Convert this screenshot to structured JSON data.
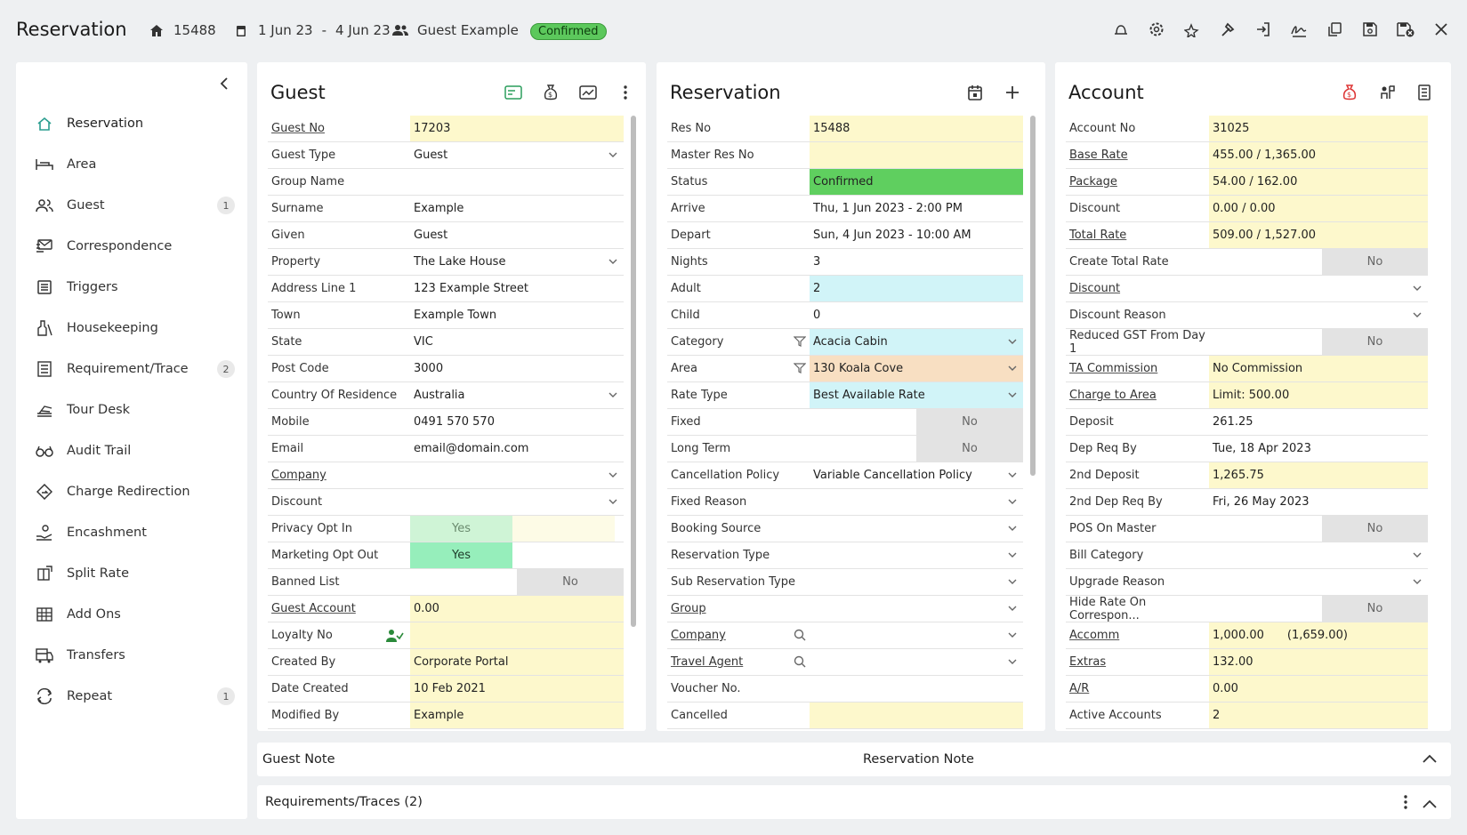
{
  "header": {
    "title": "Reservation",
    "res_no": "15488",
    "dates_from": "1 Jun 23",
    "dates_sep": "-",
    "dates_to": "4 Jun 23",
    "guest": "Guest Example",
    "status": "Confirmed"
  },
  "toolbar_icons": [
    "bell-icon",
    "gear-icon",
    "sparkle-star-icon",
    "hammer-icon",
    "sign-in-icon",
    "signature-icon",
    "copy-icon",
    "save-icon",
    "save-close-icon",
    "close-icon"
  ],
  "sidebar": {
    "items": [
      {
        "label": "Reservation",
        "icon": "home-icon",
        "count": ""
      },
      {
        "label": "Area",
        "icon": "bed-icon",
        "count": ""
      },
      {
        "label": "Guest",
        "icon": "users-icon",
        "count": "1"
      },
      {
        "label": "Correspondence",
        "icon": "mail-icon",
        "count": ""
      },
      {
        "label": "Triggers",
        "icon": "calendar-list-icon",
        "count": ""
      },
      {
        "label": "Housekeeping",
        "icon": "cleaning-icon",
        "count": ""
      },
      {
        "label": "Requirement/Trace",
        "icon": "list-icon",
        "count": "2"
      },
      {
        "label": "Tour Desk",
        "icon": "tour-icon",
        "count": ""
      },
      {
        "label": "Audit Trail",
        "icon": "glasses-icon",
        "count": ""
      },
      {
        "label": "Charge Redirection",
        "icon": "redirect-icon",
        "count": ""
      },
      {
        "label": "Encashment",
        "icon": "hand-coin-icon",
        "count": ""
      },
      {
        "label": "Split Rate",
        "icon": "split-icon",
        "count": ""
      },
      {
        "label": "Add Ons",
        "icon": "grid-icon",
        "count": ""
      },
      {
        "label": "Transfers",
        "icon": "bus-icon",
        "count": ""
      },
      {
        "label": "Repeat",
        "icon": "repeat-icon",
        "count": "1"
      }
    ]
  },
  "guest_panel": {
    "title": "Guest",
    "rows": [
      {
        "label": "Guest No",
        "value": "17203",
        "link": true,
        "bg": "yel"
      },
      {
        "label": "Guest Type",
        "value": "Guest",
        "dd": true
      },
      {
        "label": "Group Name",
        "value": ""
      },
      {
        "label": "Surname",
        "value": "Example"
      },
      {
        "label": "Given",
        "value": "Guest"
      },
      {
        "label": "Property",
        "value": "The Lake House",
        "dd": true
      },
      {
        "label": "Address Line 1",
        "value": "123 Example Street"
      },
      {
        "label": "Town",
        "value": "Example Town"
      },
      {
        "label": "State",
        "value": "VIC"
      },
      {
        "label": "Post Code",
        "value": "3000"
      },
      {
        "label": "Country Of Residence",
        "value": "Australia",
        "dd": true
      },
      {
        "label": "Mobile",
        "value": "0491 570 570"
      },
      {
        "label": "Email",
        "value": "email@domain.com"
      },
      {
        "label": "Company",
        "value": "",
        "link": true,
        "dd": true
      },
      {
        "label": "Discount",
        "value": "",
        "dd": true
      },
      {
        "label": "Privacy Opt In",
        "value": "Yes",
        "toggle": "yes-light"
      },
      {
        "label": "Marketing Opt Out",
        "value": "Yes",
        "toggle": "yes"
      },
      {
        "label": "Banned List",
        "value": "No",
        "toggle": "no"
      },
      {
        "label": "Guest Account",
        "value": "0.00",
        "link": true,
        "bg": "yel"
      },
      {
        "label": "Loyalty No",
        "value": "",
        "bg": "yel",
        "icon": "user-check-icon"
      },
      {
        "label": "Created By",
        "value": "Corporate Portal",
        "bg": "yel"
      },
      {
        "label": "Date Created",
        "value": "10 Feb 2021",
        "bg": "yel"
      },
      {
        "label": "Modified By",
        "value": "Example",
        "bg": "yel"
      }
    ]
  },
  "reservation_panel": {
    "title": "Reservation",
    "rows": [
      {
        "label": "Res No",
        "value": "15488",
        "bg": "yel"
      },
      {
        "label": "Master Res No",
        "value": "",
        "bg": "yel"
      },
      {
        "label": "Status",
        "value": "Confirmed",
        "bg": "grn"
      },
      {
        "label": "Arrive",
        "value": "Thu, 1 Jun 2023 - 2:00 PM"
      },
      {
        "label": "Depart",
        "value": "Sun, 4 Jun 2023 - 10:00 AM"
      },
      {
        "label": "Nights",
        "value": "3"
      },
      {
        "label": "Adult",
        "value": "2",
        "bg": "cyan"
      },
      {
        "label": "Child",
        "value": "0"
      },
      {
        "label": "Category",
        "value": "Acacia Cabin",
        "bg": "cyan",
        "dd": true,
        "filter": true
      },
      {
        "label": "Area",
        "value": "130 Koala Cove",
        "bg": "peach",
        "dd": true,
        "filter": true
      },
      {
        "label": "Rate Type",
        "value": "Best Available Rate",
        "bg": "cyan",
        "dd": true
      },
      {
        "label": "Fixed",
        "value": "No",
        "toggle": "no"
      },
      {
        "label": "Long Term",
        "value": "No",
        "toggle": "no"
      },
      {
        "label": "Cancellation Policy",
        "value": "Variable Cancellation Policy",
        "dd": true
      },
      {
        "label": "Fixed Reason",
        "value": "",
        "dd": true
      },
      {
        "label": "Booking Source",
        "value": "",
        "dd": true
      },
      {
        "label": "Reservation Type",
        "value": "",
        "dd": true
      },
      {
        "label": "Sub Reservation Type",
        "value": "",
        "dd": true
      },
      {
        "label": "Group",
        "value": "",
        "link": true,
        "dd": true
      },
      {
        "label": "Company",
        "value": "",
        "link": true,
        "dd": true,
        "search": true
      },
      {
        "label": "Travel Agent",
        "value": "",
        "link": true,
        "dd": true,
        "search": true
      },
      {
        "label": "Voucher No.",
        "value": ""
      },
      {
        "label": "Cancelled",
        "value": "",
        "bg": "yel"
      }
    ]
  },
  "account_panel": {
    "title": "Account",
    "rows": [
      {
        "label": "Account No",
        "value": "31025",
        "bg": "yel"
      },
      {
        "label": "Base Rate",
        "value": "455.00 / 1,365.00",
        "link": true,
        "bg": "yel"
      },
      {
        "label": "Package",
        "value": "54.00 / 162.00",
        "link": true,
        "bg": "yel"
      },
      {
        "label": "Discount",
        "value": "0.00 / 0.00",
        "bg": "yel"
      },
      {
        "label": "Total Rate",
        "value": "509.00 / 1,527.00",
        "link": true,
        "bg": "yel"
      },
      {
        "label": "Create Total Rate",
        "value": "No",
        "toggle": "no"
      },
      {
        "label": "Discount",
        "value": "",
        "link": true,
        "dd": true
      },
      {
        "label": "Discount Reason",
        "value": "",
        "dd": true
      },
      {
        "label": "Reduced GST From Day 1",
        "value": "No",
        "toggle": "no"
      },
      {
        "label": "TA Commission",
        "value": "No Commission",
        "link": true,
        "bg": "yel"
      },
      {
        "label": "Charge to Area",
        "value": "Limit: 500.00",
        "link": true,
        "bg": "yel"
      },
      {
        "label": "Deposit",
        "value": "261.25"
      },
      {
        "label": "Dep Req By",
        "value": "Tue, 18 Apr 2023"
      },
      {
        "label": "2nd Deposit",
        "value": "1,265.75",
        "bg": "yel"
      },
      {
        "label": "2nd Dep Req By",
        "value": "Fri, 26 May 2023"
      },
      {
        "label": "POS On Master",
        "value": "No",
        "toggle": "no"
      },
      {
        "label": "Bill Category",
        "value": "",
        "dd": true
      },
      {
        "label": "Upgrade Reason",
        "value": "",
        "dd": true
      },
      {
        "label": "Hide Rate On Correspon...",
        "value": "No",
        "toggle": "no"
      },
      {
        "label": "Accomm",
        "value": "1,000.00",
        "value2": "(1,659.00)",
        "link": true,
        "bg": "yel"
      },
      {
        "label": "Extras",
        "value": "132.00",
        "link": true,
        "bg": "yel"
      },
      {
        "label": "A/R",
        "value": "0.00",
        "link": true,
        "bg": "yel"
      },
      {
        "label": "Active Accounts",
        "value": "2",
        "bg": "yel"
      }
    ]
  },
  "notes": {
    "guest_note": "Guest Note",
    "reservation_note": "Reservation Note"
  },
  "requirements": {
    "label": "Requirements/Traces (2)"
  },
  "colors": {
    "yellow": "#fdf8cc",
    "green": "#5fcf5f",
    "cyan": "#d1f4f8",
    "peach": "#f8dfc2",
    "accent": "#2a9d8f"
  }
}
